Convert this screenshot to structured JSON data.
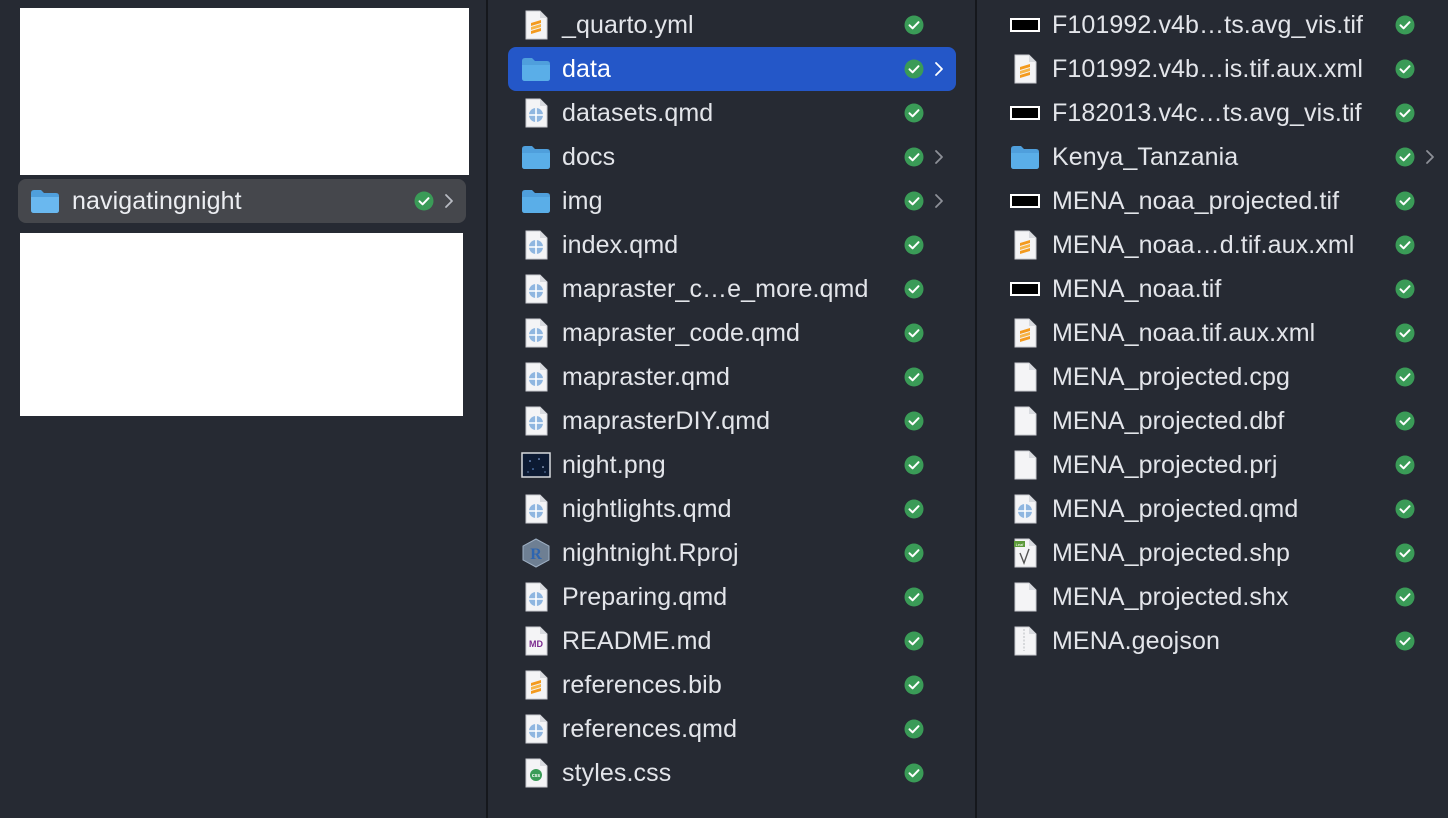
{
  "column1": {
    "selected_item": {
      "name": "navigatingnight",
      "icon": "folder-icon",
      "status": "synced",
      "has_children": true
    }
  },
  "column2": {
    "items": [
      {
        "name": "_quarto.yml",
        "icon": "sublime-file-icon",
        "status": "synced",
        "has_children": false
      },
      {
        "name": "data",
        "icon": "folder-icon",
        "status": "synced",
        "has_children": true,
        "selected": true
      },
      {
        "name": "datasets.qmd",
        "icon": "quarto-file-icon",
        "status": "synced",
        "has_children": false
      },
      {
        "name": "docs",
        "icon": "folder-icon",
        "status": "synced",
        "has_children": true
      },
      {
        "name": "img",
        "icon": "folder-icon",
        "status": "synced",
        "has_children": true
      },
      {
        "name": "index.qmd",
        "icon": "quarto-file-icon",
        "status": "synced",
        "has_children": false
      },
      {
        "name": "mapraster_c…e_more.qmd",
        "icon": "quarto-file-icon",
        "status": "synced",
        "has_children": false
      },
      {
        "name": "mapraster_code.qmd",
        "icon": "quarto-file-icon",
        "status": "synced",
        "has_children": false
      },
      {
        "name": "mapraster.qmd",
        "icon": "quarto-file-icon",
        "status": "synced",
        "has_children": false
      },
      {
        "name": "maprasterDIY.qmd",
        "icon": "quarto-file-icon",
        "status": "synced",
        "has_children": false
      },
      {
        "name": "night.png",
        "icon": "image-thumbnail-icon",
        "status": "synced",
        "has_children": false
      },
      {
        "name": "nightlights.qmd",
        "icon": "quarto-file-icon",
        "status": "synced",
        "has_children": false
      },
      {
        "name": "nightnight.Rproj",
        "icon": "r-project-icon",
        "status": "synced",
        "has_children": false
      },
      {
        "name": "Preparing.qmd",
        "icon": "quarto-file-icon",
        "status": "synced",
        "has_children": false
      },
      {
        "name": "README.md",
        "icon": "markdown-file-icon",
        "status": "synced",
        "has_children": false
      },
      {
        "name": "references.bib",
        "icon": "sublime-file-icon",
        "status": "synced",
        "has_children": false
      },
      {
        "name": "references.qmd",
        "icon": "quarto-file-icon",
        "status": "synced",
        "has_children": false
      },
      {
        "name": "styles.css",
        "icon": "css-file-icon",
        "status": "synced",
        "has_children": false
      }
    ]
  },
  "column3": {
    "items": [
      {
        "name": "F101992.v4b…ts.avg_vis.tif",
        "icon": "tif-thumbnail-icon",
        "status": "synced",
        "has_children": false
      },
      {
        "name": "F101992.v4b…is.tif.aux.xml",
        "icon": "sublime-file-icon",
        "status": "synced",
        "has_children": false
      },
      {
        "name": "F182013.v4c…ts.avg_vis.tif",
        "icon": "tif-thumbnail-icon",
        "status": "synced",
        "has_children": false
      },
      {
        "name": "Kenya_Tanzania",
        "icon": "folder-icon",
        "status": "synced",
        "has_children": true
      },
      {
        "name": "MENA_noaa_projected.tif",
        "icon": "tif-thumbnail-icon",
        "status": "synced",
        "has_children": false
      },
      {
        "name": "MENA_noaa…d.tif.aux.xml",
        "icon": "sublime-file-icon",
        "status": "synced",
        "has_children": false
      },
      {
        "name": "MENA_noaa.tif",
        "icon": "tif-thumbnail-icon",
        "status": "synced",
        "has_children": false
      },
      {
        "name": "MENA_noaa.tif.aux.xml",
        "icon": "sublime-file-icon",
        "status": "synced",
        "has_children": false
      },
      {
        "name": "MENA_projected.cpg",
        "icon": "blank-file-icon",
        "status": "synced",
        "has_children": false
      },
      {
        "name": "MENA_projected.dbf",
        "icon": "blank-file-icon",
        "status": "synced",
        "has_children": false
      },
      {
        "name": "MENA_projected.prj",
        "icon": "blank-file-icon",
        "status": "synced",
        "has_children": false
      },
      {
        "name": "MENA_projected.qmd",
        "icon": "quarto-file-icon",
        "status": "synced",
        "has_children": false
      },
      {
        "name": "MENA_projected.shp",
        "icon": "shapefile-icon",
        "status": "synced",
        "has_children": false
      },
      {
        "name": "MENA_projected.shx",
        "icon": "blank-file-icon",
        "status": "synced",
        "has_children": false
      },
      {
        "name": "MENA.geojson",
        "icon": "geojson-file-icon",
        "status": "synced",
        "has_children": false
      }
    ]
  },
  "colors": {
    "background": "#262a33",
    "selection_active": "#2457c8",
    "selection_inactive": "#45474c",
    "synced_check": "#3a9b57",
    "folder": "#5aaee8"
  },
  "icon_text": {
    "markdown": "MD",
    "css": "css",
    "rproj": "R",
    "shp": "Leaf"
  }
}
